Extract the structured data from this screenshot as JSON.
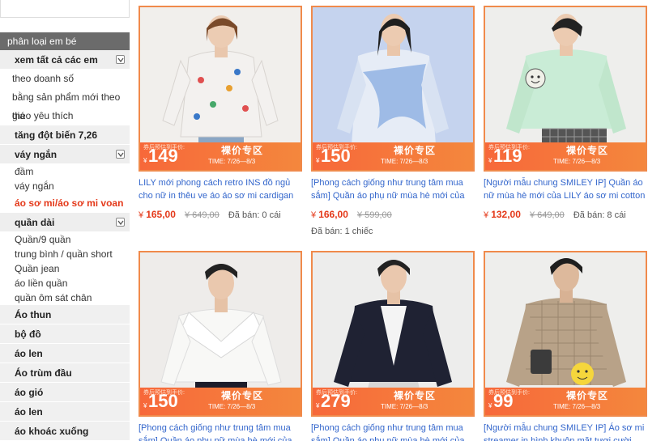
{
  "sidebar": {
    "category_header": "phân loại em bé",
    "groups": [
      {
        "label": "xem tất cả các em",
        "items": [
          "theo doanh số",
          "bằng sản phẩm mới theo giá",
          "theo yêu thích"
        ]
      },
      {
        "label": "tăng đột biến 7,26"
      },
      {
        "label": "váy ngắn",
        "items": [
          "đầm",
          "váy ngắn"
        ]
      },
      {
        "label": "áo sơ mi/áo sơ mi voan",
        "active": true
      },
      {
        "label": "quần dài",
        "items": [
          "Quần/9 quần",
          "trung bình / quần short",
          "Quần jean",
          "áo liền quần",
          "quần ôm sát chân"
        ]
      },
      {
        "label": "Áo thun"
      },
      {
        "label": "bộ đồ"
      },
      {
        "label": "áo len"
      },
      {
        "label": "Áo trùm đầu"
      },
      {
        "label": "áo gió"
      },
      {
        "label": "áo len"
      },
      {
        "label": "áo khoác xuống"
      }
    ]
  },
  "promo": {
    "tiny": "券后预估到手价:",
    "yen": "¥",
    "zone": "裸价专区",
    "time": "TIME: 7/26—8/3"
  },
  "products": [
    {
      "promo_price": "149",
      "title": "LILY mới phong cách retro INS đồ ngủ cho nữ in thêu ve áo áo sơ mi cardigan",
      "currency": "¥",
      "price": "165,00",
      "old_price": "¥ 649,00",
      "sold": "Đã bán: 0 cái",
      "sold2": ""
    },
    {
      "promo_price": "150",
      "title": "[Phong cách giống như trung tâm mua sắm] Quần áo phụ nữ mùa hè mới của LILY",
      "currency": "¥",
      "price": "166,00",
      "old_price": "¥ 599,00",
      "sold": "",
      "sold2": "Đã bán: 1 chiếc"
    },
    {
      "promo_price": "119",
      "title": "[Người mẫu chung SMILEY IP] Quần áo nữ mùa hè mới của LILY áo sơ mi cotton màu",
      "currency": "¥",
      "price": "132,00",
      "old_price": "¥ 649,00",
      "sold": "Đã bán: 8 cái",
      "sold2": ""
    },
    {
      "promo_price": "150",
      "title": "[Phong cách giống như trung tâm mua sắm] Quần áo phụ nữ mùa hè mới của LILY"
    },
    {
      "promo_price": "279",
      "title": "[Phong cách giống như trung tâm mua sắm] Quần áo phụ nữ mùa hè mới của LILY"
    },
    {
      "promo_price": "99",
      "title": "[Người mẫu chung SMILEY IP] Áo sơ mi streamer in hình khuôn mặt tươi cười cho"
    }
  ]
}
